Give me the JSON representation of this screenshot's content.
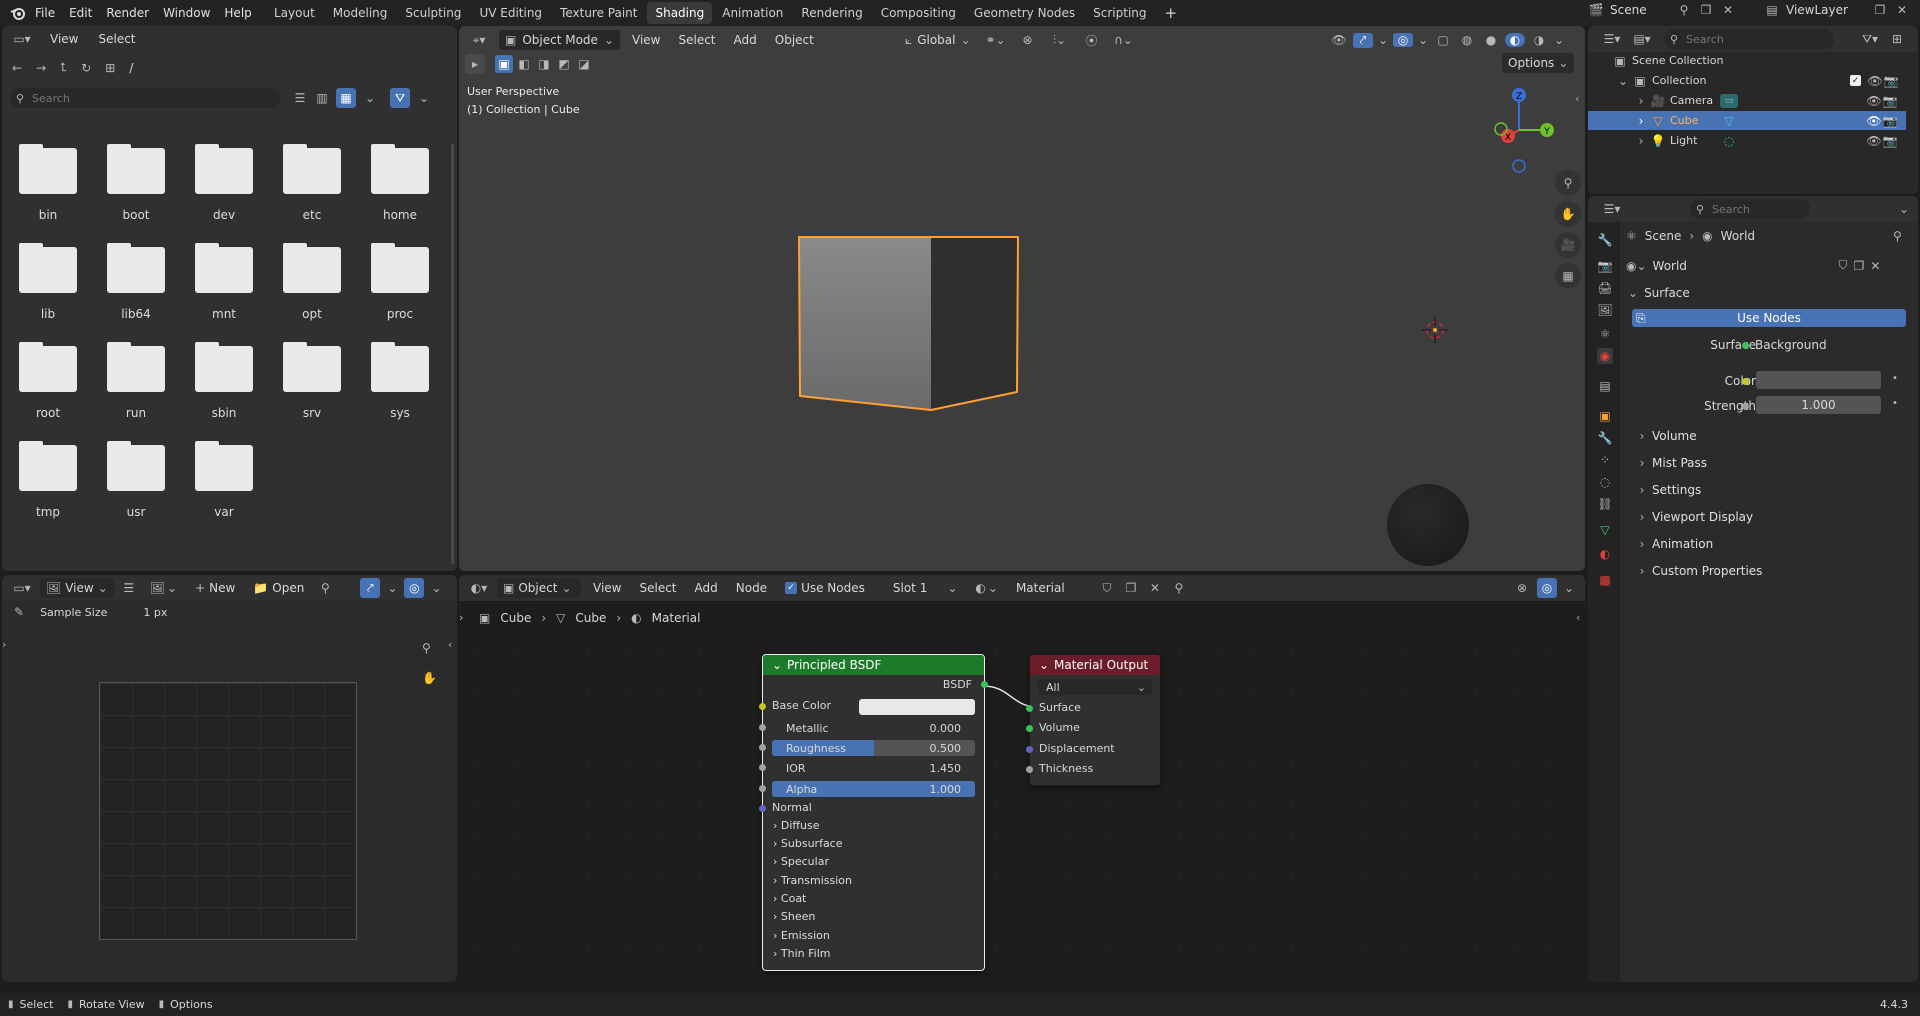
{
  "topbar": {
    "menus": [
      "File",
      "Edit",
      "Render",
      "Window",
      "Help"
    ],
    "workspaces": [
      "Layout",
      "Modeling",
      "Sculpting",
      "UV Editing",
      "Texture Paint",
      "Shading",
      "Animation",
      "Rendering",
      "Compositing",
      "Geometry Nodes",
      "Scripting"
    ],
    "active_workspace": "Shading",
    "scene": "Scene",
    "view_layer": "ViewLayer"
  },
  "filebrowser": {
    "menus": [
      "View",
      "Select"
    ],
    "path": "/",
    "search_placeholder": "Search",
    "folders": [
      "bin",
      "boot",
      "dev",
      "etc",
      "home",
      "lib",
      "lib64",
      "mnt",
      "opt",
      "proc",
      "root",
      "run",
      "sbin",
      "srv",
      "sys",
      "tmp",
      "usr",
      "var"
    ]
  },
  "viewport": {
    "mode": "Object Mode",
    "menus": [
      "View",
      "Select",
      "Add",
      "Object"
    ],
    "transform": "Global",
    "options": "Options",
    "perspective": "User Perspective",
    "collection_info": "(1) Collection | Cube",
    "gizmo": {
      "x": "X",
      "y": "Y",
      "z": "Z"
    }
  },
  "image_editor": {
    "view": "View",
    "new": "New",
    "open": "Open",
    "tool_label": "Sample Size",
    "tool_value": "1 px"
  },
  "node_editor": {
    "editor_type": "Object",
    "menus": [
      "View",
      "Select",
      "Add",
      "Node"
    ],
    "use_nodes": "Use Nodes",
    "slot": "Slot 1",
    "material": "Material",
    "breadcrumb": [
      "Cube",
      "Cube",
      "Material"
    ],
    "bsdf": {
      "title": "Principled BSDF",
      "output": "BSDF",
      "base_color": "Base Color",
      "metallic": {
        "label": "Metallic",
        "value": "0.000"
      },
      "roughness": {
        "label": "Roughness",
        "value": "0.500",
        "fraction": 0.5
      },
      "ior": {
        "label": "IOR",
        "value": "1.450"
      },
      "alpha": {
        "label": "Alpha",
        "value": "1.000",
        "fraction": 1.0
      },
      "normal": "Normal",
      "sections": [
        "Diffuse",
        "Subsurface",
        "Specular",
        "Transmission",
        "Coat",
        "Sheen",
        "Emission",
        "Thin Film"
      ]
    },
    "output": {
      "title": "Material Output",
      "target": "All",
      "inputs": [
        "Surface",
        "Volume",
        "Displacement",
        "Thickness"
      ]
    }
  },
  "outliner": {
    "search_placeholder": "Search",
    "scene_collection": "Scene Collection",
    "collection": "Collection",
    "items": [
      "Camera",
      "Cube",
      "Light"
    ],
    "selected": "Cube"
  },
  "properties": {
    "search_placeholder": "Search",
    "breadcrumb": [
      "Scene",
      "World"
    ],
    "world_name": "World",
    "surface_panel": "Surface",
    "use_nodes_button": "Use Nodes",
    "surface_label": "Surface",
    "surface_value": "Background",
    "color_label": "Color",
    "strength_label": "Strength",
    "strength_value": "1.000",
    "panels": [
      "Volume",
      "Mist Pass",
      "Settings",
      "Viewport Display",
      "Animation",
      "Custom Properties"
    ]
  },
  "statusbar": {
    "select": "Select",
    "rotate": "Rotate View",
    "options": "Options",
    "version": "4.4.3"
  },
  "colors": {
    "accent_blue": "#4772b3",
    "selection_orange": "#ffa033",
    "bsdf_header": "#1d7a2b",
    "output_header": "#6b1d2a"
  }
}
